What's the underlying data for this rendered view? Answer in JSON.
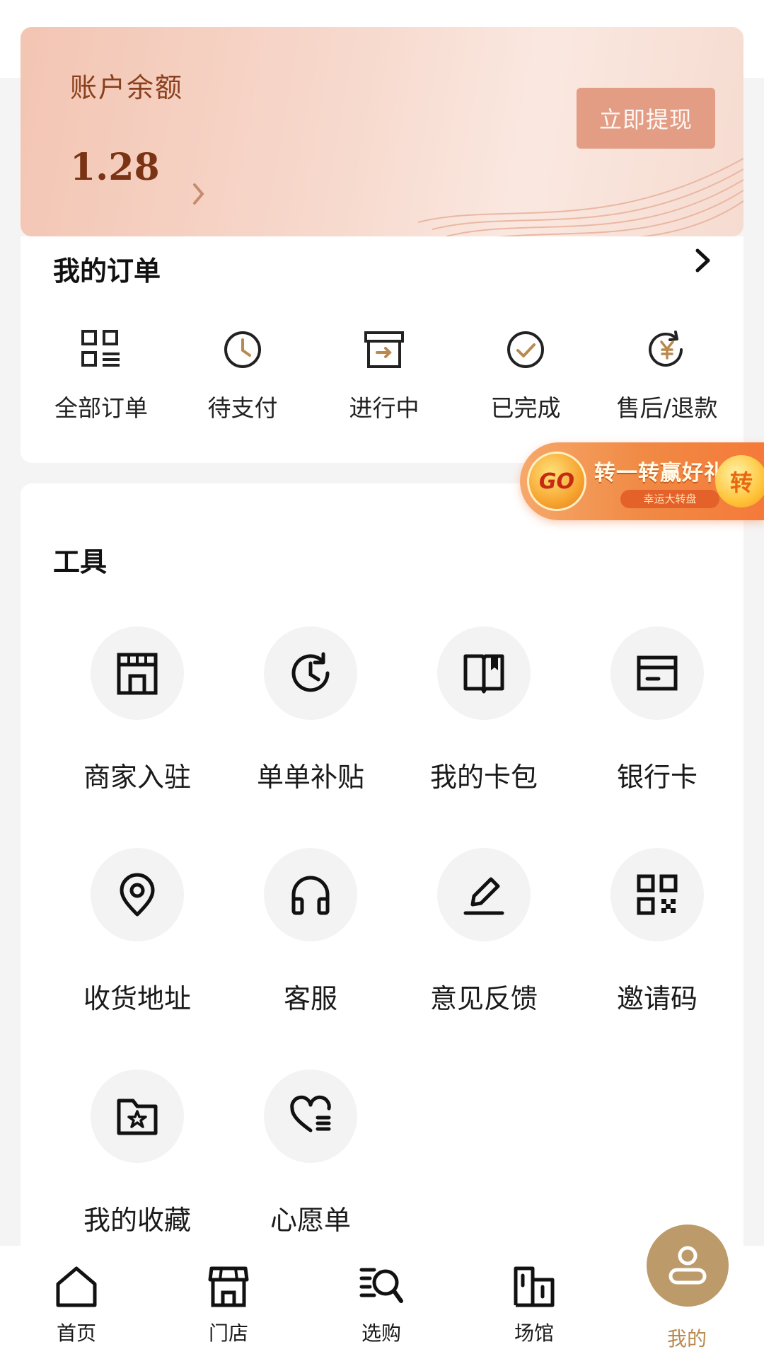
{
  "balance": {
    "title": "账户余额",
    "amount": "1.28",
    "withdraw_label": "立即提现"
  },
  "orders": {
    "title": "我的订单",
    "items": [
      {
        "label": "全部订单",
        "icon": "grid-list-icon"
      },
      {
        "label": "待支付",
        "icon": "clock-icon"
      },
      {
        "label": "进行中",
        "icon": "box-arrow-icon"
      },
      {
        "label": "已完成",
        "icon": "check-circle-icon"
      },
      {
        "label": "售后/退款",
        "icon": "yuan-refund-icon"
      }
    ]
  },
  "promo": {
    "badge": "GO",
    "title": "转一转赢好礼",
    "subtitle": "幸运大转盘",
    "spin": "转"
  },
  "tools": {
    "title": "工具",
    "items": [
      {
        "label": "商家入驻",
        "icon": "storefront-icon"
      },
      {
        "label": "单单补贴",
        "icon": "clock-refresh-icon"
      },
      {
        "label": "我的卡包",
        "icon": "book-icon"
      },
      {
        "label": "银行卡",
        "icon": "card-icon"
      },
      {
        "label": "收货地址",
        "icon": "location-pin-icon"
      },
      {
        "label": "客服",
        "icon": "headphones-icon"
      },
      {
        "label": "意见反馈",
        "icon": "pen-icon"
      },
      {
        "label": "邀请码",
        "icon": "qr-code-icon"
      },
      {
        "label": "我的收藏",
        "icon": "folder-star-icon"
      },
      {
        "label": "心愿单",
        "icon": "heart-list-icon"
      }
    ]
  },
  "nav": {
    "items": [
      {
        "label": "首页",
        "icon": "home-icon"
      },
      {
        "label": "门店",
        "icon": "store-icon"
      },
      {
        "label": "选购",
        "icon": "search-list-icon"
      },
      {
        "label": "场馆",
        "icon": "building-icon"
      },
      {
        "label": "我的",
        "icon": "user-icon"
      }
    ],
    "active": "我的"
  },
  "colors": {
    "accent_gold": "#bc9a6a",
    "balance_text": "#8a3f1c",
    "withdraw_button": "#e39d85",
    "page_bg": "#f4f4f4"
  }
}
